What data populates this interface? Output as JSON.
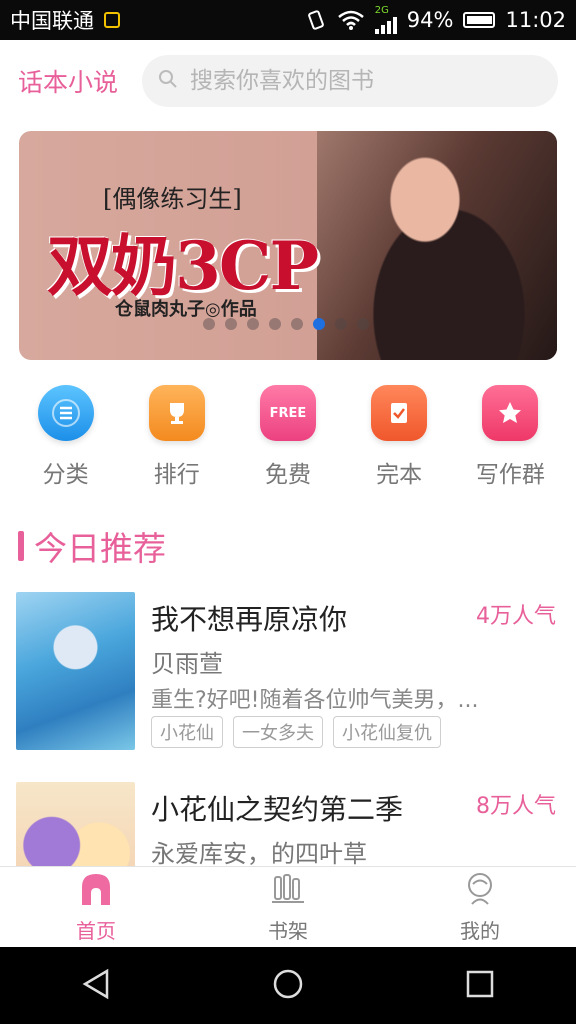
{
  "status_bar": {
    "carrier": "中国联通",
    "network": "2G",
    "battery": "94%",
    "time": "11:02"
  },
  "header": {
    "app_title": "话本小说",
    "search_placeholder": "搜索你喜欢的图书"
  },
  "banner": {
    "tag": "[偶像练习生]",
    "title": "双奶3CP",
    "author": "仓鼠肉丸子◎作品",
    "dot_count": 8,
    "active_dot": 5
  },
  "categories": [
    {
      "label": "分类",
      "icon": "list-icon",
      "color": "#2b9cf0"
    },
    {
      "label": "排行",
      "icon": "trophy-icon",
      "color": "#f79a2e"
    },
    {
      "label": "免费",
      "icon": "free-icon",
      "color": "#f0568c"
    },
    {
      "label": "完本",
      "icon": "check-icon",
      "color": "#f5673b"
    },
    {
      "label": "写作群",
      "icon": "star-icon",
      "color": "#f24c7c"
    }
  ],
  "section": {
    "title": "今日推荐"
  },
  "books": [
    {
      "title": "我不想再原凉你",
      "popularity": "4万人气",
      "author": "贝雨萱",
      "description": "重生?好吧!随着各位帅气美男，...",
      "tags": [
        "小花仙",
        "一女多夫",
        "小花仙复仇"
      ]
    },
    {
      "title": "小花仙之契约第二季",
      "popularity": "8万人气",
      "author": "永爱库安，的四叶草",
      "description": "",
      "tags": []
    }
  ],
  "bottom_nav": [
    {
      "label": "首页",
      "icon": "home-icon",
      "active": true
    },
    {
      "label": "书架",
      "icon": "bookshelf-icon",
      "active": false
    },
    {
      "label": "我的",
      "icon": "profile-icon",
      "active": false
    }
  ],
  "colors": {
    "accent": "#e8609a"
  }
}
